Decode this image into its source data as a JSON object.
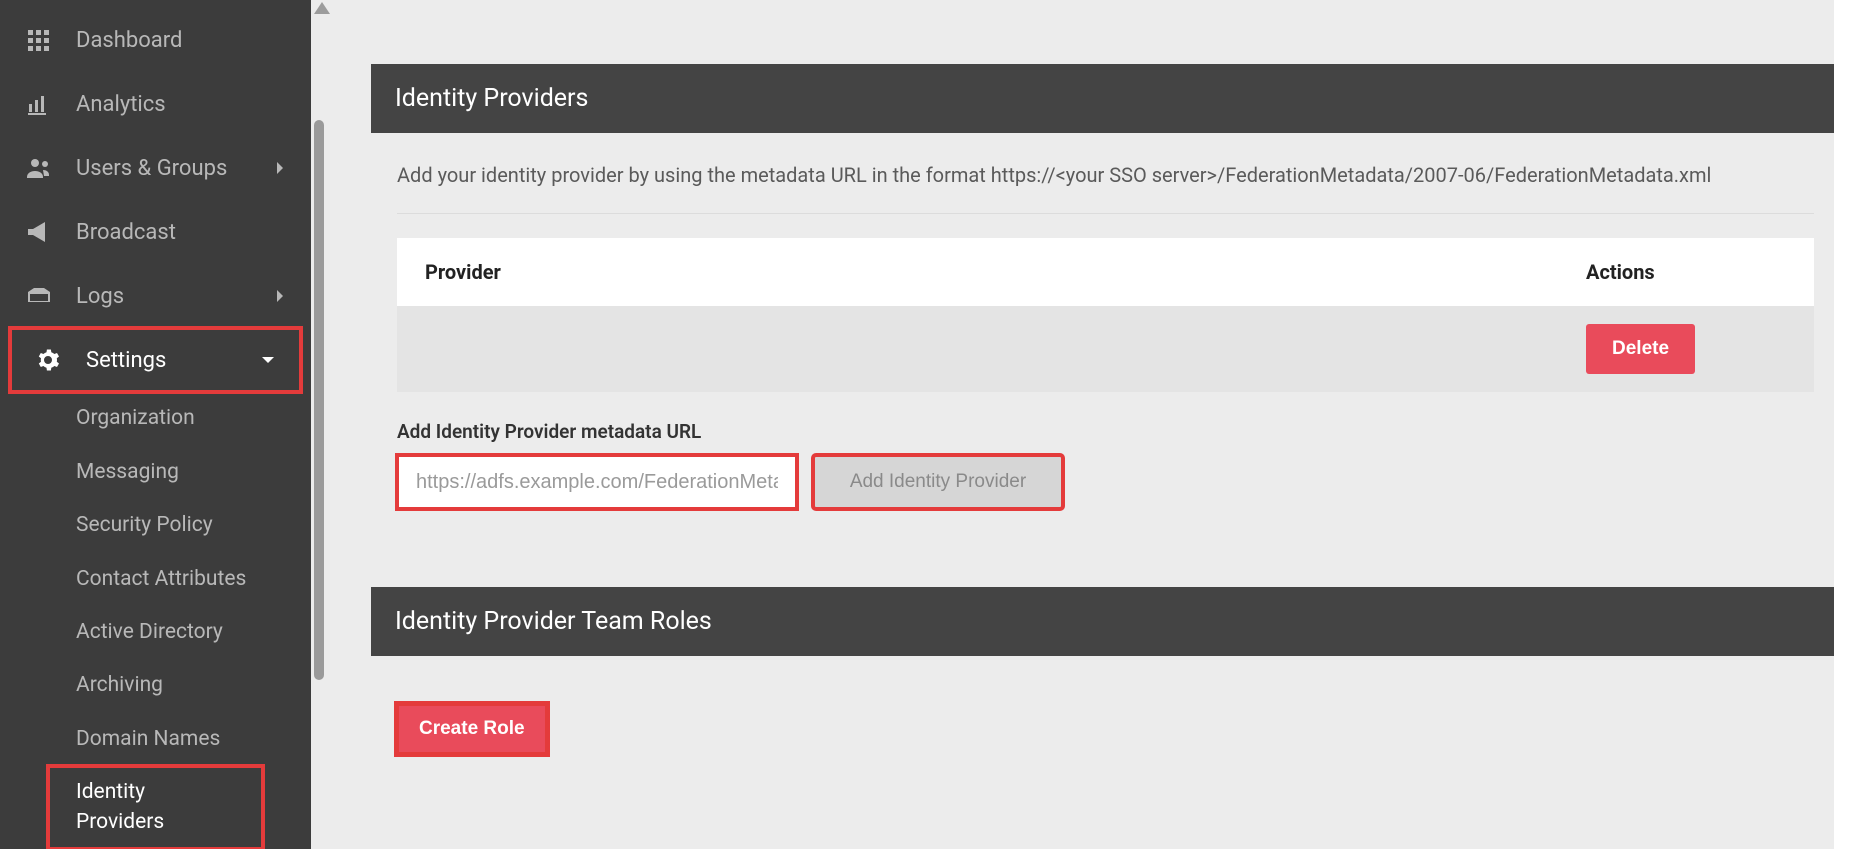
{
  "sidebar": {
    "items": [
      {
        "label": "Dashboard"
      },
      {
        "label": "Analytics"
      },
      {
        "label": "Users & Groups"
      },
      {
        "label": "Broadcast"
      },
      {
        "label": "Logs"
      },
      {
        "label": "Settings"
      }
    ],
    "settings_sub": [
      {
        "label": "Organization"
      },
      {
        "label": "Messaging"
      },
      {
        "label": "Security Policy"
      },
      {
        "label": "Contact Attributes"
      },
      {
        "label": "Active Directory"
      },
      {
        "label": "Archiving"
      },
      {
        "label": "Domain Names"
      },
      {
        "label": "Identity Providers"
      }
    ]
  },
  "panels": {
    "idp": {
      "title": "Identity Providers",
      "helper": "Add your identity provider by using the metadata URL in the format https://<your SSO server>/FederationMetadata/2007-06/FederationMetadata.xml",
      "col_provider": "Provider",
      "col_actions": "Actions",
      "delete_label": "Delete",
      "add_label": "Add Identity Provider metadata URL",
      "add_placeholder": "https://adfs.example.com/FederationMetadata",
      "add_button": "Add Identity Provider"
    },
    "roles": {
      "title": "Identity Provider Team Roles",
      "create_label": "Create Role"
    }
  }
}
